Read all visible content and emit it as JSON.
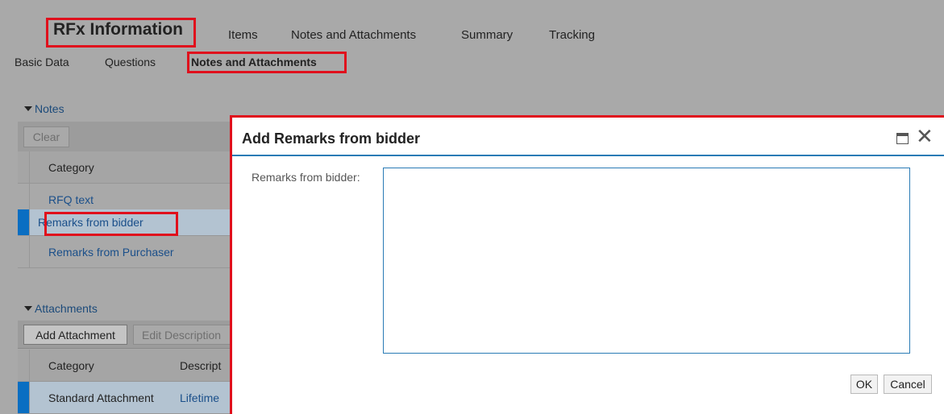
{
  "header": {
    "title": "RFx Information",
    "tabs": [
      "Items",
      "Notes and Attachments",
      "Summary",
      "Tracking"
    ]
  },
  "subtabs": [
    "Basic Data",
    "Questions",
    "Notes and Attachments"
  ],
  "notes": {
    "section_title": "Notes",
    "clear_button": "Clear",
    "column_category": "Category",
    "rows": [
      "RFQ text",
      "Remarks from bidder",
      "Remarks from Purchaser"
    ]
  },
  "attachments": {
    "section_title": "Attachments",
    "add_button": "Add Attachment",
    "edit_button": "Edit Description",
    "column_category": "Category",
    "column_description": "Descript",
    "row_category": "Standard Attachment",
    "row_description": "Lifetime"
  },
  "dialog": {
    "title": "Add Remarks from bidder",
    "field_label": "Remarks from bidder:",
    "field_value": "",
    "ok_button": "OK",
    "cancel_button": "Cancel",
    "maximize_icon": "maximize-icon",
    "close_icon": "close-icon"
  },
  "colors": {
    "highlight": "#e0101c",
    "dialog_accent": "#2a7bb5",
    "selection": "#0a6ec2"
  }
}
